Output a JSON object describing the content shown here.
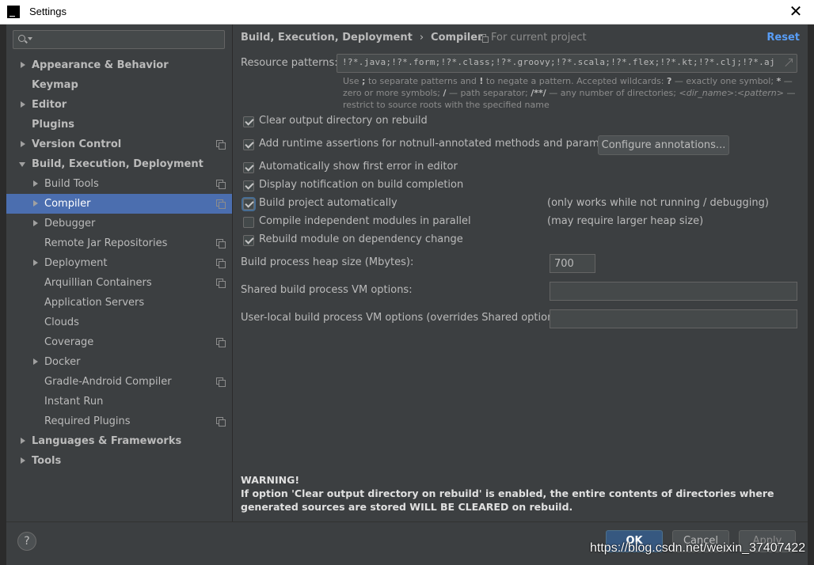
{
  "window": {
    "title": "Settings",
    "app_icon_letter": "IJ",
    "close_glyph": "✕"
  },
  "search": {
    "value": "",
    "placeholder": ""
  },
  "tree": [
    {
      "label": "Appearance & Behavior",
      "level": 0,
      "arrow": "right",
      "bold": true,
      "project_icon": false
    },
    {
      "label": "Keymap",
      "level": 0,
      "arrow": "none",
      "bold": true,
      "project_icon": false
    },
    {
      "label": "Editor",
      "level": 0,
      "arrow": "right",
      "bold": true,
      "project_icon": false
    },
    {
      "label": "Plugins",
      "level": 0,
      "arrow": "none",
      "bold": true,
      "project_icon": false
    },
    {
      "label": "Version Control",
      "level": 0,
      "arrow": "right",
      "bold": true,
      "project_icon": true
    },
    {
      "label": "Build, Execution, Deployment",
      "level": 0,
      "arrow": "down",
      "bold": true,
      "project_icon": false
    },
    {
      "label": "Build Tools",
      "level": 1,
      "arrow": "right",
      "bold": false,
      "project_icon": true
    },
    {
      "label": "Compiler",
      "level": 1,
      "arrow": "right",
      "bold": false,
      "project_icon": true,
      "selected": true
    },
    {
      "label": "Debugger",
      "level": 1,
      "arrow": "right",
      "bold": false,
      "project_icon": false
    },
    {
      "label": "Remote Jar Repositories",
      "level": 1,
      "arrow": "none",
      "bold": false,
      "project_icon": true
    },
    {
      "label": "Deployment",
      "level": 1,
      "arrow": "right",
      "bold": false,
      "project_icon": true
    },
    {
      "label": "Arquillian Containers",
      "level": 1,
      "arrow": "none",
      "bold": false,
      "project_icon": true
    },
    {
      "label": "Application Servers",
      "level": 1,
      "arrow": "none",
      "bold": false,
      "project_icon": false
    },
    {
      "label": "Clouds",
      "level": 1,
      "arrow": "none",
      "bold": false,
      "project_icon": false
    },
    {
      "label": "Coverage",
      "level": 1,
      "arrow": "none",
      "bold": false,
      "project_icon": true
    },
    {
      "label": "Docker",
      "level": 1,
      "arrow": "right",
      "bold": false,
      "project_icon": false
    },
    {
      "label": "Gradle-Android Compiler",
      "level": 1,
      "arrow": "none",
      "bold": false,
      "project_icon": true
    },
    {
      "label": "Instant Run",
      "level": 1,
      "arrow": "none",
      "bold": false,
      "project_icon": false
    },
    {
      "label": "Required Plugins",
      "level": 1,
      "arrow": "none",
      "bold": false,
      "project_icon": true
    },
    {
      "label": "Languages & Frameworks",
      "level": 0,
      "arrow": "right",
      "bold": true,
      "project_icon": false
    },
    {
      "label": "Tools",
      "level": 0,
      "arrow": "right",
      "bold": true,
      "project_icon": false
    }
  ],
  "header": {
    "crumb_parent": "Build, Execution, Deployment",
    "crumb_sep": "›",
    "crumb_current": "Compiler",
    "scope": "For current project",
    "reset": "Reset"
  },
  "resource": {
    "label": "Resource patterns:",
    "value": "!?*.java;!?*.form;!?*.class;!?*.groovy;!?*.scala;!?*.flex;!?*.kt;!?*.clj;!?*.aj",
    "help_1": "Use ",
    "help_semi": ";",
    "help_2": " to separate patterns and ",
    "help_bang": "!",
    "help_3": " to negate a pattern. Accepted wildcards: ",
    "help_q": "?",
    "help_4": " — exactly one symbol; ",
    "help_star": "*",
    "help_5": " — zero or more symbols; ",
    "help_slash": "/",
    "help_6": " — path separator; ",
    "help_dstar": "/**/",
    "help_7": " — any number of directories; ",
    "help_dir": "<dir_name>",
    "help_colon": ":",
    "help_pattern": "<pattern>",
    "help_8": " — restrict to source roots with the specified name"
  },
  "options": {
    "clear_output": {
      "label": "Clear output directory on rebuild",
      "checked": true
    },
    "runtime_assertions": {
      "label": "Add runtime assertions for notnull-annotated methods and parameters",
      "checked": true
    },
    "configure_annotations": "Configure annotations...",
    "show_first_error": {
      "label": "Automatically show first error in editor",
      "checked": true
    },
    "display_notification": {
      "label": "Display notification on build completion",
      "checked": true
    },
    "build_auto": {
      "label": "Build project automatically",
      "checked": true,
      "note": "(only works while not running / debugging)"
    },
    "compile_parallel": {
      "label": "Compile independent modules in parallel",
      "checked": false,
      "note": "(may require larger heap size)"
    },
    "rebuild_on_dep": {
      "label": "Rebuild module on dependency change",
      "checked": true
    }
  },
  "heap": {
    "label": "Build process heap size (Mbytes):",
    "value": "700"
  },
  "shared_vm": {
    "label": "Shared build process VM options:",
    "value": ""
  },
  "user_vm": {
    "label": "User-local build process VM options (overrides Shared options):",
    "value": ""
  },
  "warning": {
    "title": "WARNING!",
    "body": "If option 'Clear output directory on rebuild' is enabled, the entire contents of directories where generated sources are stored WILL BE CLEARED on rebuild."
  },
  "buttons": {
    "help": "?",
    "ok": "OK",
    "cancel": "Cancel",
    "apply": "Apply"
  },
  "watermark": "https://blog.csdn.net/weixin_37407422"
}
